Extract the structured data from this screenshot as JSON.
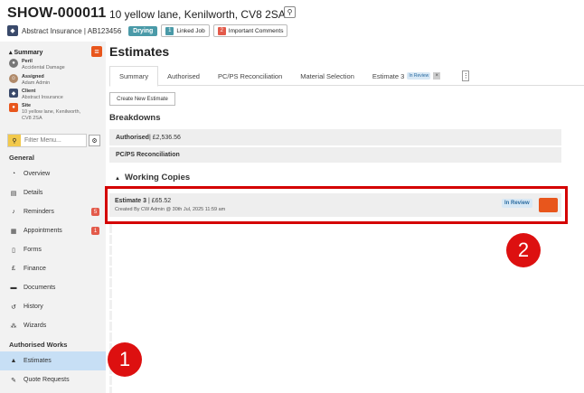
{
  "header": {
    "job_id": "SHOW-000011",
    "address": "10 yellow lane, Kenilworth, CV8 2SA",
    "client": "Abstract Insurance | AB123456",
    "status": "Drying",
    "linked_count": "1",
    "linked_label": "Linked Job",
    "comments_count": "2",
    "comments_label": "Important Comments"
  },
  "summary": {
    "title": "Summary",
    "items": [
      {
        "label": "Peril",
        "value": "Accidental Damage"
      },
      {
        "label": "Assigned",
        "value": "Adam Admin"
      },
      {
        "label": "Client",
        "value": "Abstract Insurance"
      },
      {
        "label": "Site",
        "value": "10 yellow lane, Kenilworth,",
        "value2": "CV8 2SA"
      }
    ]
  },
  "search": {
    "placeholder": "Filter Menu..."
  },
  "nav": {
    "general_title": "General",
    "items": [
      {
        "label": "Overview",
        "icon": "gauge-icon"
      },
      {
        "label": "Details",
        "icon": "clipboard-icon"
      },
      {
        "label": "Reminders",
        "icon": "bell-icon",
        "badge": "5"
      },
      {
        "label": "Appointments",
        "icon": "calendar-icon",
        "badge": "1"
      },
      {
        "label": "Forms",
        "icon": "file-icon"
      },
      {
        "label": "Finance",
        "icon": "pound-icon"
      },
      {
        "label": "Documents",
        "icon": "folder-icon"
      },
      {
        "label": "History",
        "icon": "history-icon"
      },
      {
        "label": "Wizards",
        "icon": "wand-icon"
      }
    ],
    "authorised_title": "Authorised Works",
    "authorised_items": [
      {
        "label": "Estimates",
        "icon": "bell-service-icon"
      },
      {
        "label": "Quote Requests",
        "icon": "pen-icon"
      }
    ]
  },
  "main": {
    "title": "Estimates",
    "tabs": [
      {
        "label": "Summary"
      },
      {
        "label": "Authorised"
      },
      {
        "label": "PC/PS Reconciliation"
      },
      {
        "label": "Material Selection"
      },
      {
        "label": "Estimate 3",
        "badge": "In Review"
      }
    ],
    "create_button": "Create New Estimate",
    "breakdowns_title": "Breakdowns",
    "authorised_label": "Authorised",
    "authorised_value": " | £2,536.56",
    "pcps_label": "PC/PS Reconciliation",
    "working_title": "Working Copies",
    "working_copy": {
      "name": "Estimate 3",
      "amount": " | £65.52",
      "created": "Created By CW Admin @ 30th Jul, 2025 11:59 am",
      "status": "In Review"
    }
  },
  "markers": {
    "one": "1",
    "two": "2"
  },
  "colors": {
    "accent": "#e8561c",
    "highlight": "#d40000",
    "active_nav": "#c7dff5",
    "status_teal": "#4a9aa8"
  }
}
